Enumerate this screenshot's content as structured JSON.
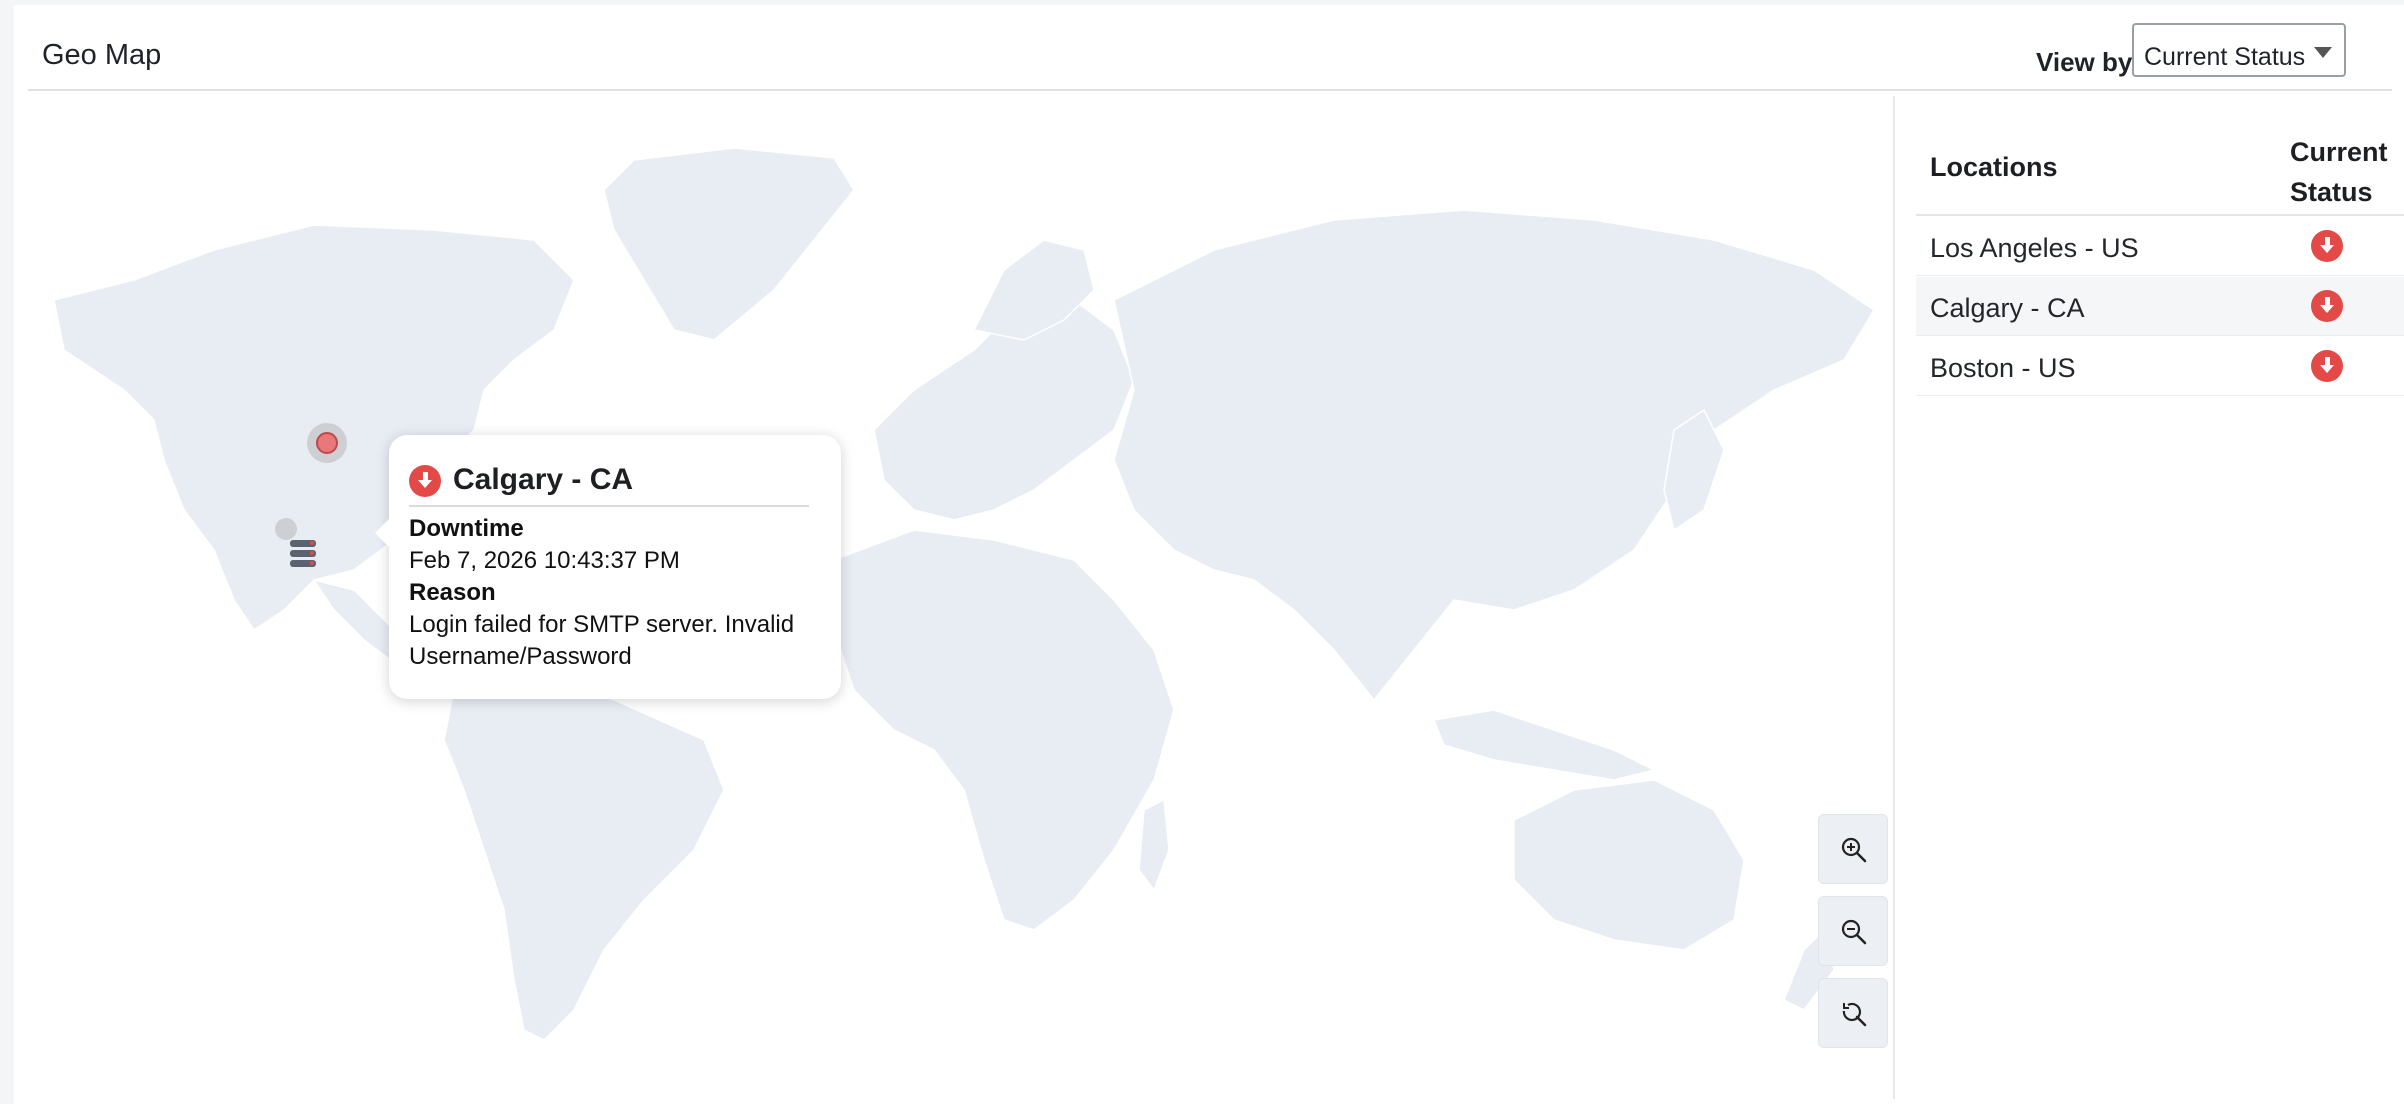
{
  "header": {
    "title": "Geo Map",
    "view_by_label": "View by",
    "view_by_value": "Current Status"
  },
  "tooltip": {
    "title": "Calgary - CA",
    "downtime_label": "Downtime",
    "downtime_value": "Feb 7, 2026 10:43:37 PM",
    "reason_label": "Reason",
    "reason_value": "Login failed for SMTP server. Invalid Username/Password",
    "status_icon": "down-arrow-icon",
    "status_color": "#e34a47"
  },
  "table": {
    "columns": {
      "location": "Locations",
      "status": "Current\nStatus"
    },
    "rows": [
      {
        "location": "Los Angeles - US",
        "status": "down"
      },
      {
        "location": "Calgary - CA",
        "status": "down"
      },
      {
        "location": "Boston - US",
        "status": "down"
      }
    ]
  },
  "zoom_controls": [
    "zoom-in-icon",
    "zoom-out-icon",
    "reset-zoom-icon"
  ],
  "colors": {
    "land": "#e8edf4",
    "down": "#e34a47",
    "marker": "#e8787a"
  }
}
